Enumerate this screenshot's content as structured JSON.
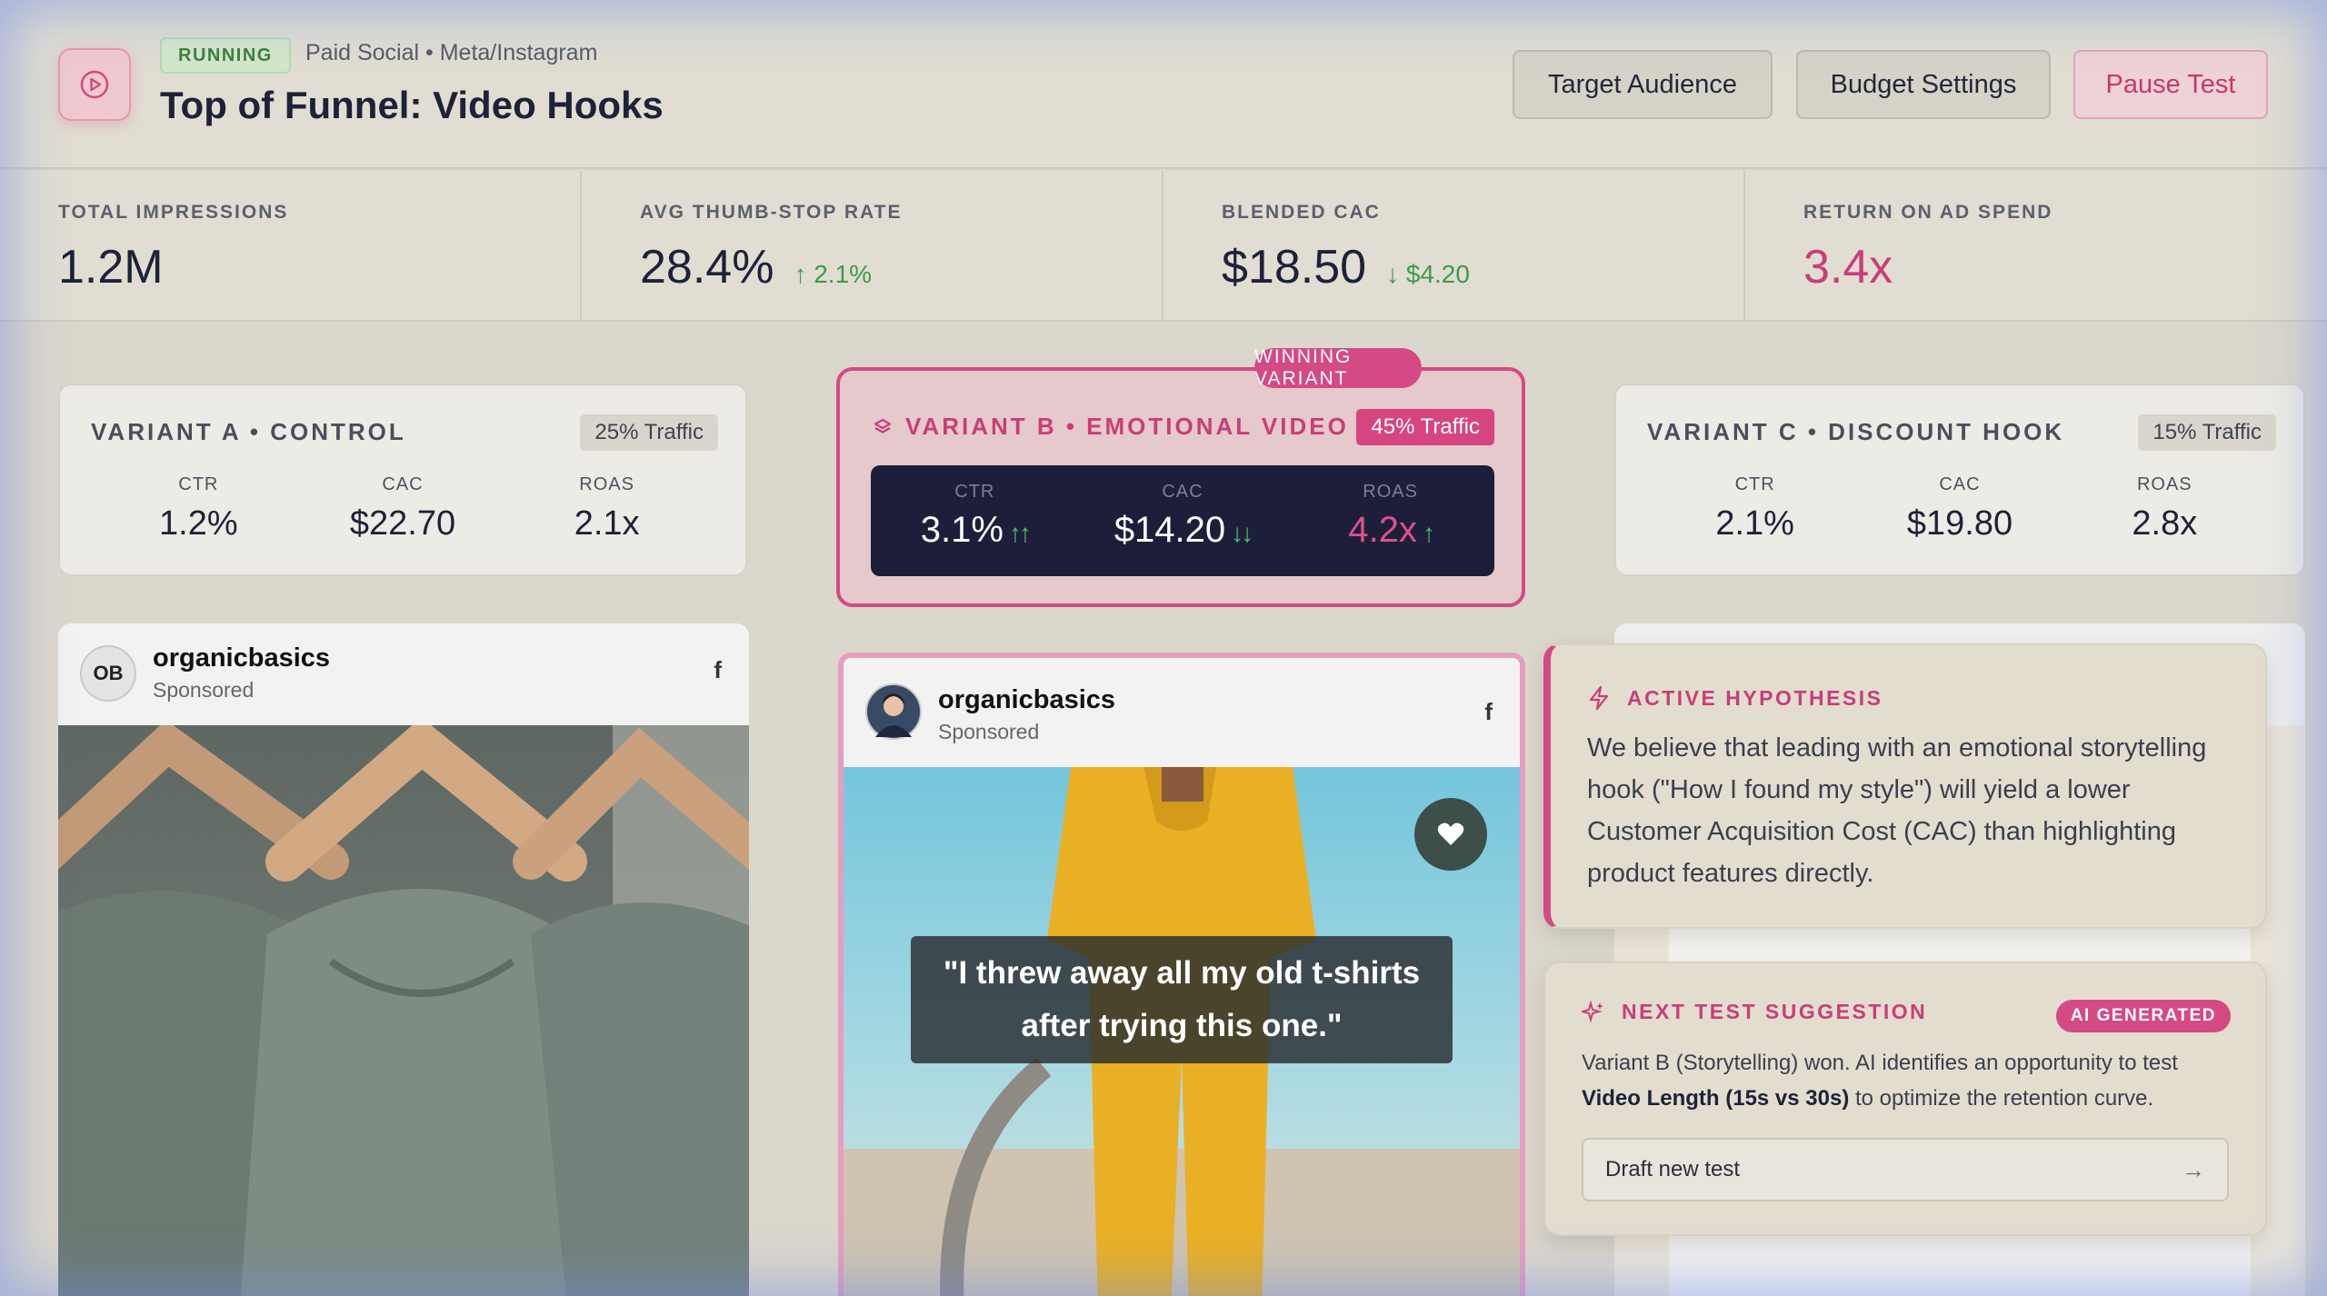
{
  "header": {
    "status": "RUNNING",
    "channel": "Paid Social • Meta/Instagram",
    "title": "Top of Funnel: Video Hooks",
    "buttons": {
      "target_audience": "Target Audience",
      "budget_settings": "Budget Settings",
      "pause_test": "Pause Test"
    }
  },
  "stats": [
    {
      "label": "TOTAL IMPRESSIONS",
      "value": "1.2M",
      "delta": ""
    },
    {
      "label": "AVG THUMB-STOP RATE",
      "value": "28.4%",
      "delta": "↑ 2.1%"
    },
    {
      "label": "BLENDED CAC",
      "value": "$18.50",
      "delta": "↓ $4.20"
    },
    {
      "label": "RETURN ON AD SPEND",
      "value": "3.4x",
      "delta": ""
    }
  ],
  "variants": {
    "a": {
      "title": "VARIANT A • CONTROL",
      "traffic": "25% Traffic",
      "labels": [
        "CTR",
        "CAC",
        "ROAS"
      ],
      "values": [
        "1.2%",
        "$22.70",
        "2.1x"
      ]
    },
    "b": {
      "tag": "WINNING VARIANT",
      "title": "VARIANT B • EMOTIONAL VIDEO",
      "traffic": "45% Traffic",
      "labels": [
        "CTR",
        "CAC",
        "ROAS"
      ],
      "values": [
        "3.1%",
        "$14.20",
        "4.2x"
      ],
      "arrows": [
        "↑↑",
        "↓↓",
        "↑"
      ]
    },
    "c": {
      "title": "VARIANT C • DISCOUNT HOOK",
      "traffic": "15% Traffic",
      "labels": [
        "CTR",
        "CAC",
        "ROAS"
      ],
      "values": [
        "2.1%",
        "$19.80",
        "2.8x"
      ]
    }
  },
  "ads": {
    "a": {
      "avatar": "OB",
      "brand": "organicbasics",
      "sponsored": "Sponsored"
    },
    "b": {
      "brand": "organicbasics",
      "sponsored": "Sponsored",
      "caption": "\"I threw away all my old t-shirts after trying this one.\""
    }
  },
  "hypothesis": {
    "title": "ACTIVE HYPOTHESIS",
    "text": "We believe that leading with an emotional storytelling hook (\"How I found my style\") will yield a lower Customer Acquisition Cost (CAC) than highlighting product features directly."
  },
  "suggestion": {
    "title": "NEXT TEST SUGGESTION",
    "tag": "AI GENERATED",
    "text_before": "Variant B (Storytelling) won. AI identifies an opportunity to test ",
    "text_bold": "Video Length (15s vs 30s)",
    "text_after": " to optimize the retention curve.",
    "draft_label": "Draft new test"
  },
  "colors": {
    "accent": "#d44a85",
    "positive": "#3e9a4f",
    "dark": "#1d1f3a"
  }
}
